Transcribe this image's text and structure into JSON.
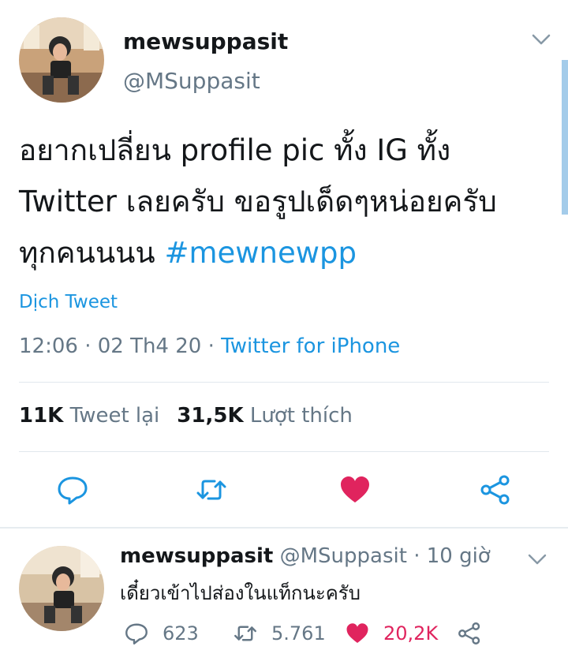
{
  "main_tweet": {
    "display_name": "mewsuppasit",
    "handle": "@MSuppasit",
    "text_lines": [
      "อยากเปลี่ยน profile pic ทั้ง IG ทั้ง",
      "Twitter เลยครับ ขอรูปเด็ดๆหน่อยครับ",
      "ทุกคนนนน "
    ],
    "hashtag": "#mewnewpp",
    "translate_label": "Dịch Tweet",
    "timestamp": "12:06 · 02 Th4 20 · ",
    "source": "Twitter for iPhone",
    "retweet_count": "11K",
    "retweet_label": "Tweet lại",
    "like_count": "31,5K",
    "like_label": "Lượt thích",
    "icons": [
      "reply-icon",
      "retweet-icon",
      "like-heart-icon",
      "share-icon"
    ]
  },
  "reply_tweet": {
    "display_name": "mewsuppasit",
    "handle": "@MSuppasit",
    "time": "· 10 giờ",
    "text": "เดี๋ยวเข้าไปส่องในแท็กนะครับ",
    "reply_count": "623",
    "retweet_count": "5.761",
    "like_count": "20,2K"
  },
  "colors": {
    "accent": "#1b95e0",
    "like": "#e0245e",
    "muted": "#657786",
    "divider": "#e1e8ed"
  }
}
